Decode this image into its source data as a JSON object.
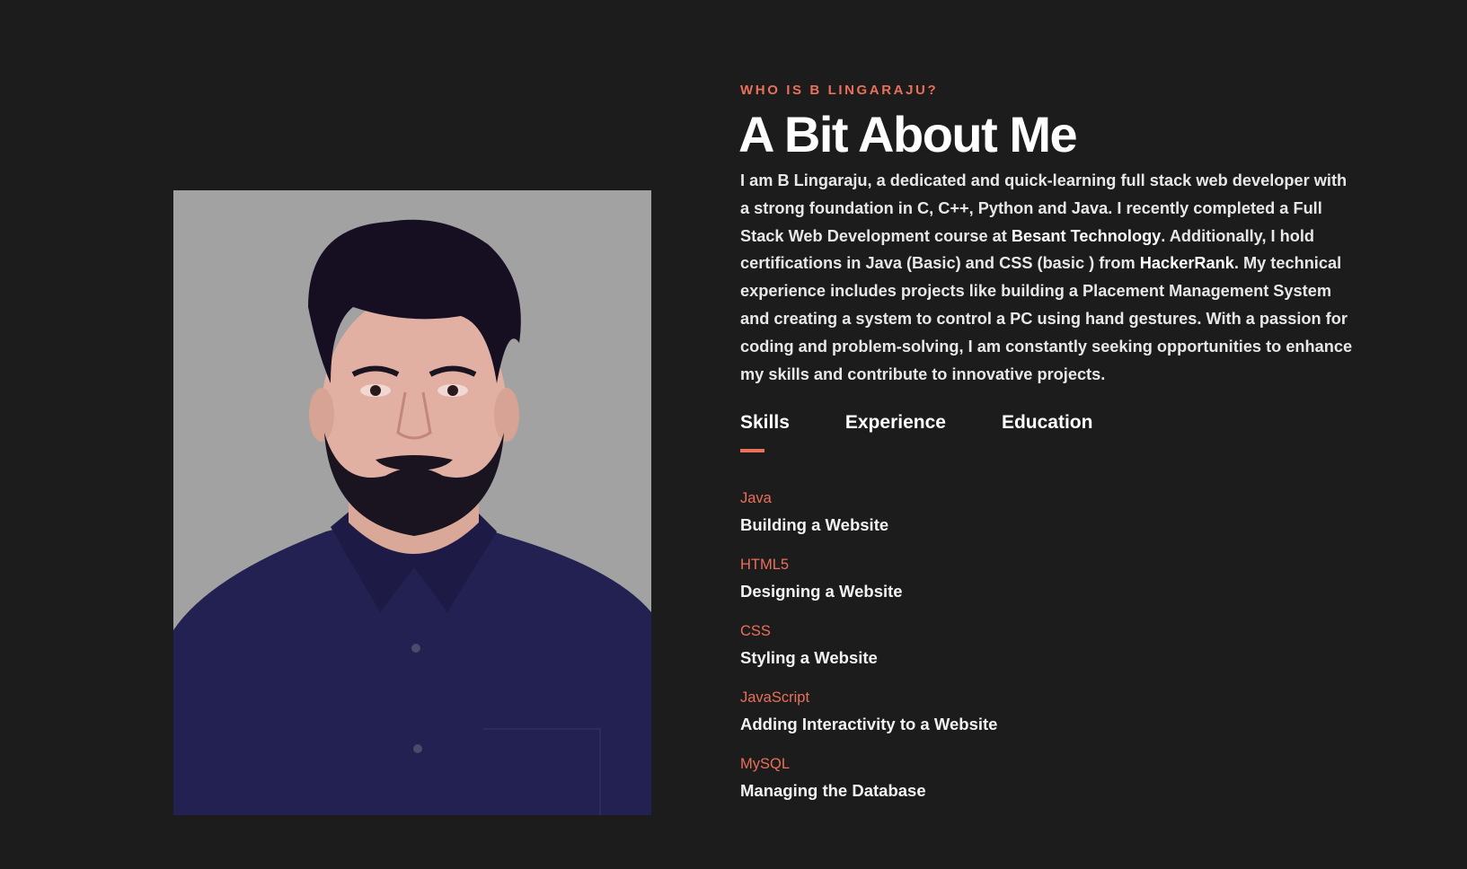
{
  "about": {
    "eyebrow": "WHO IS B LINGARAJU?",
    "heading": "A Bit About Me",
    "bio": {
      "part1": "I am B Lingaraju, a dedicated and quick-learning full stack web developer with a strong foundation in C, C++, Python and Java. I recently completed a Full Stack Web Development course at ",
      "institute": "Besant Technology",
      "part2": ". Additionally, I hold certifications in Java (Basic) and CSS (basic ) from ",
      "platform": "HackerRank",
      "part3": ". My technical experience includes projects like building a Placement Management System and creating a system to control a PC using hand gestures. With a passion for coding and problem-solving, I am constantly seeking opportunities to enhance my skills and contribute to innovative projects."
    }
  },
  "tabs": [
    {
      "label": "Skills",
      "active": true
    },
    {
      "label": "Experience",
      "active": false
    },
    {
      "label": "Education",
      "active": false
    }
  ],
  "skills": [
    {
      "name": "Java",
      "description": "Building a Website"
    },
    {
      "name": "HTML5",
      "description": "Designing a Website"
    },
    {
      "name": "CSS",
      "description": "Styling a Website"
    },
    {
      "name": "JavaScript",
      "description": "Adding Interactivity to a Website"
    },
    {
      "name": "MySQL",
      "description": "Managing the Database"
    }
  ],
  "colors": {
    "background": "#1c1c1c",
    "accent": "#e9705a",
    "text": "#ffffff",
    "photo_background": "#a2a2a2",
    "shirt": "#232052"
  },
  "icons": {
    "profile_photo": "portrait-photo"
  }
}
